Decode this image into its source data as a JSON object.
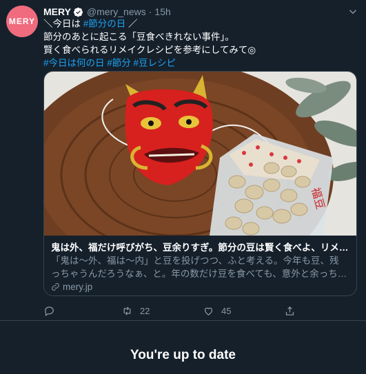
{
  "tweet": {
    "avatar_text": "MERY",
    "name": "MERY",
    "handle": "@mery_news",
    "separator": "·",
    "time": "15h",
    "lines": [
      {
        "pre": "＼今日は ",
        "link": "#節分の日",
        "post": " ／"
      },
      {
        "pre": "節分のあとに起こる「豆食べきれない事件」。",
        "link": "",
        "post": ""
      },
      {
        "pre": "賢く食べられるリメイクレシピを参考にしてみて◎",
        "link": "",
        "post": ""
      }
    ],
    "hashtags": "#今日は何の日 #節分 #豆レシピ",
    "card": {
      "title": "鬼は外、福だけ呼びがち、豆余りすぎ。節分の豆は賢く食べよ、リメ…",
      "desc1": "「鬼は〜外、福は〜内」と豆を投げつつ、ふと考える。今年も豆、残",
      "desc2": "っちゃうんだろうなぁ、と。年の数だけ豆を食べても、意外と余っち…",
      "domain": "mery.jp",
      "image_desc_label": "福豆"
    },
    "actions": {
      "reply_count": "",
      "retweet_count": "22",
      "like_count": "45"
    }
  },
  "footer": {
    "up_to_date": "You're up to date"
  },
  "colors": {
    "background": "#15202b",
    "accent": "#1da1f2",
    "muted": "#8899a6",
    "avatar": "#ef6b7d"
  }
}
